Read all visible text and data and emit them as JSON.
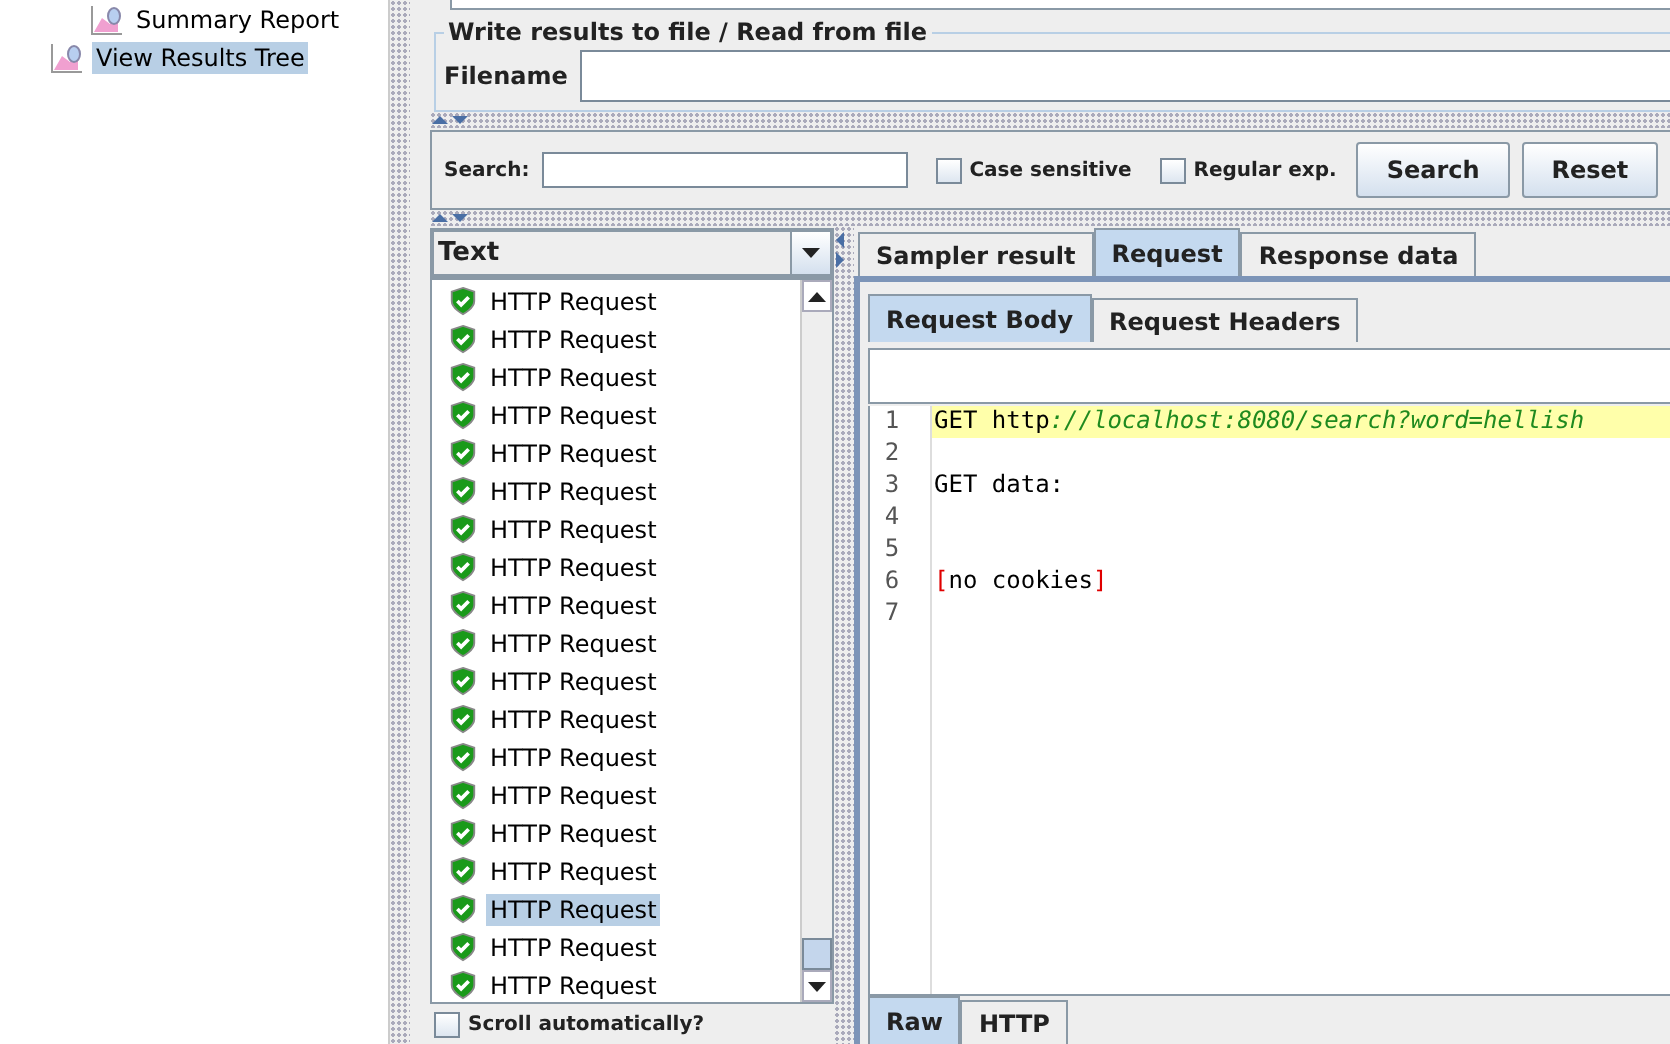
{
  "tree": {
    "items": [
      {
        "label": "Summary Report",
        "selected": false
      },
      {
        "label": "View Results Tree",
        "selected": true
      }
    ]
  },
  "file_panel": {
    "title": "Write results to file / Read from file",
    "filename_label": "Filename"
  },
  "search_bar": {
    "label": "Search:",
    "options": [
      {
        "label": "Case sensitive",
        "checked": false
      },
      {
        "label": "Regular exp.",
        "checked": false
      }
    ],
    "buttons": [
      "Search",
      "Reset"
    ]
  },
  "results": {
    "renderer": "Text",
    "items": [
      {
        "label": "HTTP Request",
        "selected": false
      },
      {
        "label": "HTTP Request",
        "selected": false
      },
      {
        "label": "HTTP Request",
        "selected": false
      },
      {
        "label": "HTTP Request",
        "selected": false
      },
      {
        "label": "HTTP Request",
        "selected": false
      },
      {
        "label": "HTTP Request",
        "selected": false
      },
      {
        "label": "HTTP Request",
        "selected": false
      },
      {
        "label": "HTTP Request",
        "selected": false
      },
      {
        "label": "HTTP Request",
        "selected": false
      },
      {
        "label": "HTTP Request",
        "selected": false
      },
      {
        "label": "HTTP Request",
        "selected": false
      },
      {
        "label": "HTTP Request",
        "selected": false
      },
      {
        "label": "HTTP Request",
        "selected": false
      },
      {
        "label": "HTTP Request",
        "selected": false
      },
      {
        "label": "HTTP Request",
        "selected": false
      },
      {
        "label": "HTTP Request",
        "selected": false
      },
      {
        "label": "HTTP Request",
        "selected": true
      },
      {
        "label": "HTTP Request",
        "selected": false
      },
      {
        "label": "HTTP Request",
        "selected": false
      }
    ],
    "scroll_option": {
      "label": "Scroll automatically?",
      "checked": false
    }
  },
  "tabs": [
    {
      "label": "Sampler result",
      "selected": false
    },
    {
      "label": "Request",
      "selected": true
    },
    {
      "label": "Response data",
      "selected": false
    }
  ],
  "subtabs": [
    {
      "label": "Request Body",
      "selected": true
    },
    {
      "label": "Request Headers",
      "selected": false
    }
  ],
  "editor": {
    "lines": [
      {
        "number": "1",
        "highlighted": true,
        "segments": [
          {
            "kind": "plain",
            "text": "GET http"
          },
          {
            "kind": "url",
            "text": "://localhost:8080/search?word=hellish"
          }
        ]
      },
      {
        "number": "2",
        "highlighted": false
      },
      {
        "number": "3",
        "highlighted": false,
        "segments": [
          {
            "kind": "plain",
            "text": "GET data:"
          }
        ]
      },
      {
        "number": "4",
        "highlighted": false
      },
      {
        "number": "5",
        "highlighted": false
      },
      {
        "number": "6",
        "highlighted": false,
        "segments": [
          {
            "kind": "bracket",
            "text": "["
          },
          {
            "kind": "plain",
            "text": "no cookies"
          },
          {
            "kind": "bracket",
            "text": "]"
          }
        ]
      },
      {
        "number": "7",
        "highlighted": false
      }
    ]
  },
  "bottom_tabs": [
    {
      "label": "Raw",
      "selected": true
    },
    {
      "label": "HTTP",
      "selected": false
    }
  ]
}
